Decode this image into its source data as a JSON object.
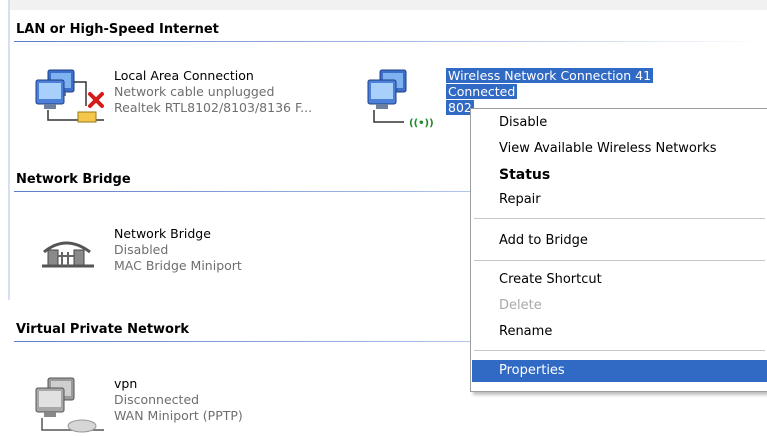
{
  "groups": [
    {
      "title": "LAN or High-Speed Internet"
    },
    {
      "title": "Network Bridge"
    },
    {
      "title": "Virtual Private Network"
    }
  ],
  "lan": {
    "name": "Local Area Connection",
    "status": "Network cable unplugged",
    "device": "Realtek RTL8102/8103/8136 F..."
  },
  "wireless": {
    "name": "Wireless Network Connection 41",
    "status": "Connected",
    "device": "802"
  },
  "bridge": {
    "name": "Network Bridge",
    "status": "Disabled",
    "device": "MAC Bridge Miniport"
  },
  "vpn": {
    "name": "vpn",
    "status": "Disconnected",
    "device": "WAN Miniport (PPTP)"
  },
  "context_menu": {
    "items": [
      {
        "label": "Disable"
      },
      {
        "label": "View Available Wireless Networks"
      },
      {
        "label": "Status"
      },
      {
        "label": "Repair"
      },
      {
        "label": "Add to Bridge"
      },
      {
        "label": "Create Shortcut"
      },
      {
        "label": "Delete"
      },
      {
        "label": "Rename"
      },
      {
        "label": "Properties"
      }
    ]
  },
  "colors": {
    "selection": "#316ac5",
    "header_rule": "#5b7ec8",
    "disabled_text": "#a9a9a9"
  }
}
